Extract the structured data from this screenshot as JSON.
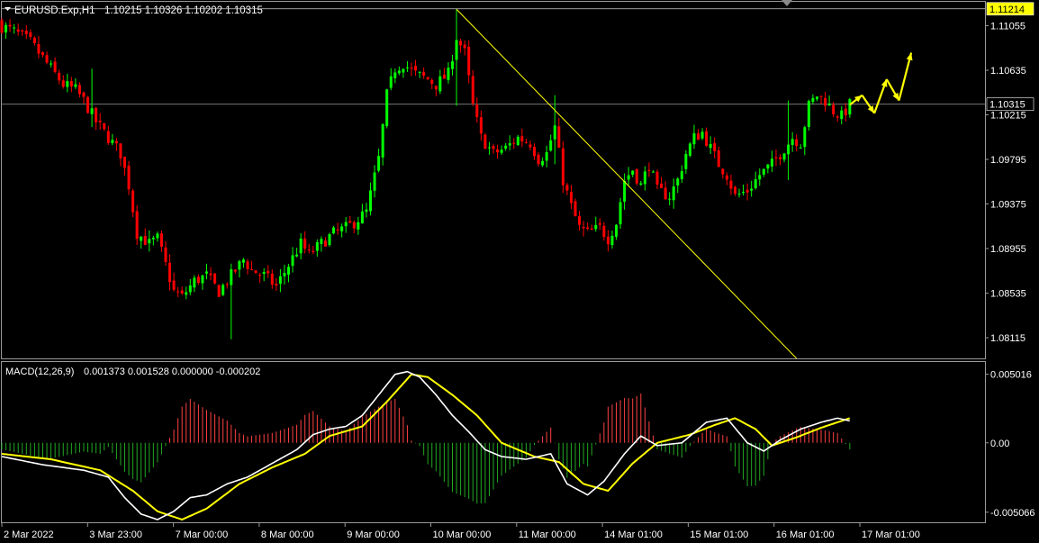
{
  "header": {
    "symbol": "EURUSD.Exp,H1",
    "quote": "1.10215 1.10326 1.10202 1.10315"
  },
  "colors": {
    "background": "#000000",
    "bull_candle": "#00ff00",
    "bear_candle": "#ff0000",
    "trendline": "#ffff00",
    "arrow": "#ffff00",
    "macd_main": "#ffffff",
    "macd_signal": "#ffff00",
    "hist_positive": "#ff4040",
    "hist_negative": "#22aa22",
    "axis_text": "#ffffff",
    "price_label_high_bg": "#ffff00"
  },
  "chart_data": [
    {
      "type": "candlestick",
      "symbol": "EURUSD.Exp",
      "timeframe": "H1",
      "price_labels": {
        "high": "1.11214",
        "current": "1.10315"
      },
      "y_ticks": [
        "1.11055",
        "1.10635",
        "1.10215",
        "1.09795",
        "1.09375",
        "1.08955",
        "1.08535",
        "1.08115"
      ],
      "ylim": [
        1.0792,
        1.1128
      ],
      "grid": false,
      "x_ticks": [
        "2 Mar 2022",
        "3 Mar 23:00",
        "7 Mar 00:00",
        "8 Mar 00:00",
        "9 Mar 00:00",
        "10 Mar 00:00",
        "11 Mar 00:00",
        "14 Mar 01:00",
        "15 Mar 01:00",
        "16 Mar 01:00",
        "17 Mar 01:00"
      ],
      "close_path": [
        [
          0,
          1.1105
        ],
        [
          3,
          1.11
        ],
        [
          7,
          1.109
        ],
        [
          10,
          1.1075
        ],
        [
          13,
          1.106
        ],
        [
          15,
          1.105
        ],
        [
          18,
          1.1045
        ],
        [
          20,
          1.1035
        ],
        [
          23,
          1.1015
        ],
        [
          26,
          1.1
        ],
        [
          29,
          1.0985
        ],
        [
          31,
          1.0955
        ],
        [
          33,
          1.091
        ],
        [
          36,
          1.09
        ],
        [
          38,
          1.0905
        ],
        [
          40,
          1.088
        ],
        [
          42,
          1.0855
        ],
        [
          44,
          1.085
        ],
        [
          47,
          1.0865
        ],
        [
          50,
          1.087
        ],
        [
          53,
          1.0855
        ],
        [
          56,
          1.087
        ],
        [
          59,
          1.0885
        ],
        [
          61,
          1.0875
        ],
        [
          64,
          1.087
        ],
        [
          67,
          1.086
        ],
        [
          70,
          1.088
        ],
        [
          73,
          1.09
        ],
        [
          75,
          1.089
        ],
        [
          78,
          1.09
        ],
        [
          81,
          1.091
        ],
        [
          84,
          1.0915
        ],
        [
          86,
          1.092
        ],
        [
          89,
          1.093
        ],
        [
          92,
          1.098
        ],
        [
          94,
          1.104
        ],
        [
          96,
          1.1065
        ],
        [
          98,
          1.107
        ],
        [
          101,
          1.106
        ],
        [
          104,
          1.1055
        ],
        [
          106,
          1.105
        ],
        [
          109,
          1.106
        ],
        [
          111,
          1.1095
        ],
        [
          113,
          1.108
        ],
        [
          115,
          1.103
        ],
        [
          117,
          1.1
        ],
        [
          120,
          1.0985
        ],
        [
          123,
          1.099
        ],
        [
          126,
          1.1
        ],
        [
          129,
          1.0995
        ],
        [
          131,
          1.098
        ],
        [
          133,
          1.0985
        ],
        [
          135,
          1.101
        ],
        [
          137,
          1.096
        ],
        [
          139,
          1.0935
        ],
        [
          141,
          1.0915
        ],
        [
          143,
          1.091
        ],
        [
          146,
          1.0915
        ],
        [
          148,
          1.0905
        ],
        [
          150,
          1.092
        ],
        [
          152,
          1.096
        ],
        [
          154,
          1.097
        ],
        [
          156,
          1.0955
        ],
        [
          158,
          1.0975
        ],
        [
          160,
          1.095
        ],
        [
          163,
          1.0945
        ],
        [
          165,
          1.096
        ],
        [
          167,
          1.0985
        ],
        [
          169,
          1.1
        ],
        [
          171,
          1.1005
        ],
        [
          173,
          1.099
        ],
        [
          175,
          1.0975
        ],
        [
          177,
          1.0965
        ],
        [
          179,
          1.0945
        ],
        [
          182,
          1.095
        ],
        [
          185,
          1.0965
        ],
        [
          188,
          1.0975
        ],
        [
          190,
          1.0985
        ],
        [
          193,
          1.1
        ],
        [
          195,
          1.0995
        ],
        [
          197,
          1.103
        ],
        [
          199,
          1.104
        ],
        [
          201,
          1.1035
        ],
        [
          203,
          1.1025
        ],
        [
          205,
          1.102
        ],
        [
          207,
          1.1031
        ]
      ],
      "spikes": [
        [
          22,
          1.1065,
          1.101
        ],
        [
          56,
          1.088,
          1.081
        ],
        [
          111,
          1.1121,
          1.103
        ],
        [
          135,
          1.104,
          1.0975
        ],
        [
          192,
          1.1035,
          1.096
        ]
      ],
      "trendline": {
        "from": [
          111,
          1.1121
        ],
        "to": [
          194,
          1.0792
        ]
      },
      "forecast_arrows": [
        [
          [
            207,
            1.1031
          ],
          [
            210,
            1.104
          ]
        ],
        [
          [
            210,
            1.104
          ],
          [
            213,
            1.1023
          ]
        ],
        [
          [
            213,
            1.1023
          ],
          [
            216,
            1.1055
          ]
        ],
        [
          [
            216,
            1.1055
          ],
          [
            219,
            1.1035
          ]
        ],
        [
          [
            219,
            1.1035
          ],
          [
            222,
            1.108
          ]
        ]
      ]
    },
    {
      "type": "macd",
      "title": "MACD(12,26,9)",
      "values_text": "0.001373 0.001528 0.000000 -0.000202",
      "y_ticks": [
        "0.005016",
        "0.00",
        "-0.005066"
      ],
      "ylim": [
        -0.0058,
        0.0059
      ],
      "main_line": [
        [
          0,
          -0.001
        ],
        [
          10,
          -0.0016
        ],
        [
          20,
          -0.002
        ],
        [
          26,
          -0.0025
        ],
        [
          30,
          -0.004
        ],
        [
          34,
          -0.0052
        ],
        [
          38,
          -0.0056
        ],
        [
          42,
          -0.005
        ],
        [
          46,
          -0.004
        ],
        [
          50,
          -0.0038
        ],
        [
          55,
          -0.003
        ],
        [
          60,
          -0.0025
        ],
        [
          66,
          -0.0015
        ],
        [
          72,
          -0.0005
        ],
        [
          76,
          0.0006
        ],
        [
          80,
          0.001
        ],
        [
          84,
          0.0012
        ],
        [
          88,
          0.002
        ],
        [
          92,
          0.0035
        ],
        [
          96,
          0.005
        ],
        [
          99,
          0.0052
        ],
        [
          102,
          0.0048
        ],
        [
          106,
          0.0035
        ],
        [
          110,
          0.002
        ],
        [
          114,
          0.0008
        ],
        [
          118,
          -0.0005
        ],
        [
          122,
          -0.001
        ],
        [
          128,
          -0.0012
        ],
        [
          134,
          -0.0008
        ],
        [
          138,
          -0.003
        ],
        [
          143,
          -0.0038
        ],
        [
          147,
          -0.0028
        ],
        [
          152,
          -0.0008
        ],
        [
          156,
          0.0005
        ],
        [
          160,
          -0.0002
        ],
        [
          166,
          0.0
        ],
        [
          172,
          0.0015
        ],
        [
          177,
          0.0018
        ],
        [
          182,
          0.0
        ],
        [
          186,
          -0.0006
        ],
        [
          190,
          0.0002
        ],
        [
          195,
          0.001
        ],
        [
          200,
          0.0015
        ],
        [
          204,
          0.0018
        ],
        [
          207,
          0.0016
        ]
      ],
      "signal_line": [
        [
          0,
          -0.0008
        ],
        [
          12,
          -0.0012
        ],
        [
          24,
          -0.002
        ],
        [
          32,
          -0.0035
        ],
        [
          38,
          -0.005
        ],
        [
          44,
          -0.0056
        ],
        [
          50,
          -0.0048
        ],
        [
          58,
          -0.003
        ],
        [
          66,
          -0.0018
        ],
        [
          74,
          -0.0008
        ],
        [
          80,
          0.0005
        ],
        [
          88,
          0.0012
        ],
        [
          94,
          0.003
        ],
        [
          100,
          0.005
        ],
        [
          104,
          0.0048
        ],
        [
          110,
          0.0035
        ],
        [
          116,
          0.002
        ],
        [
          122,
          0.0
        ],
        [
          130,
          -0.001
        ],
        [
          136,
          -0.0014
        ],
        [
          142,
          -0.003
        ],
        [
          148,
          -0.0035
        ],
        [
          154,
          -0.0015
        ],
        [
          160,
          0.0
        ],
        [
          168,
          0.0006
        ],
        [
          174,
          0.0013
        ],
        [
          179,
          0.0018
        ],
        [
          184,
          0.001
        ],
        [
          188,
          -0.0002
        ],
        [
          194,
          0.0004
        ],
        [
          200,
          0.0011
        ],
        [
          207,
          0.0018
        ]
      ]
    }
  ]
}
